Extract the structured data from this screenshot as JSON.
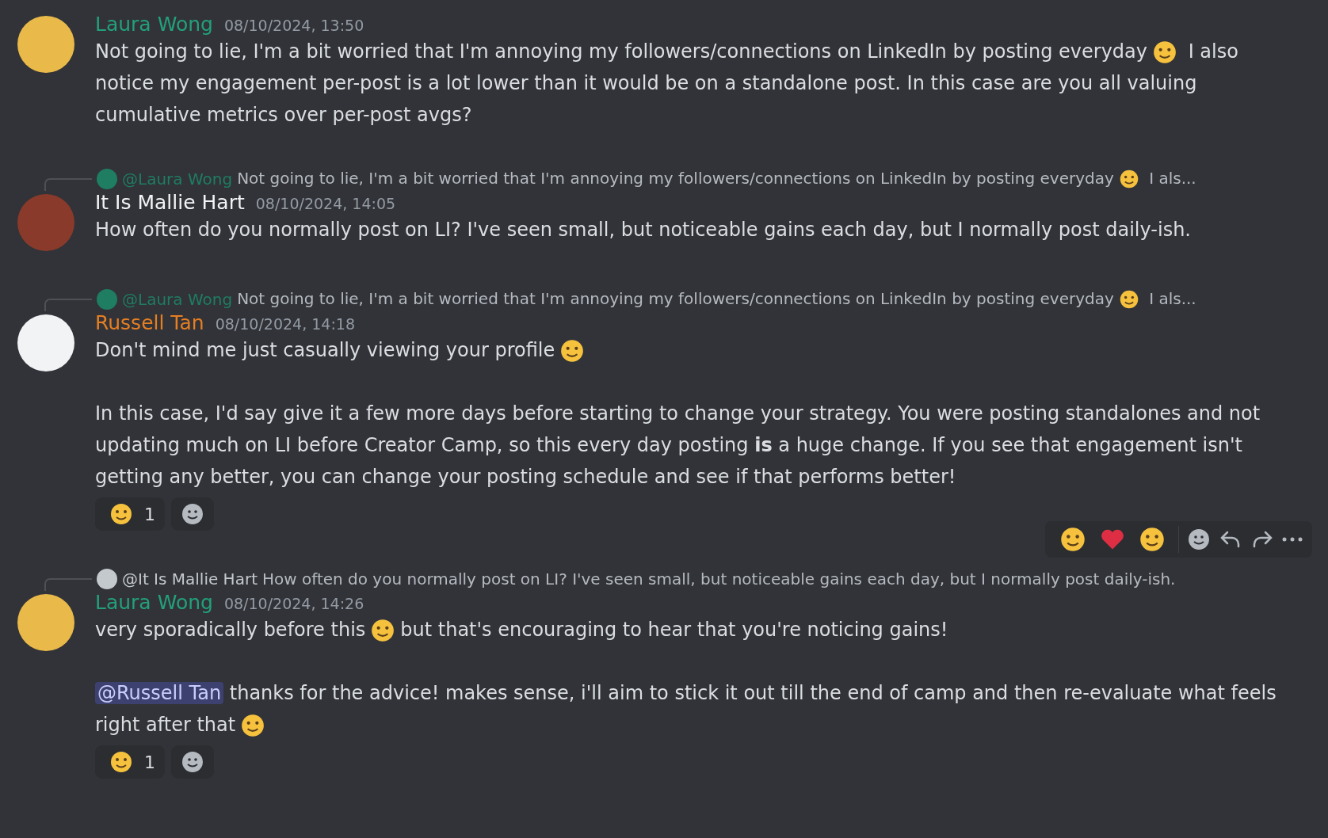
{
  "messages": [
    {
      "author": {
        "name": "Laura Wong",
        "color": "#23a07a",
        "avatar": {
          "color": "#e9b949"
        }
      },
      "timestamp": "08/10/2024, 13:50",
      "hovered": false,
      "paragraphs": [
        [
          {
            "kind": "text",
            "text": "Not going to lie, I'm a bit worried that I'm annoying my followers/connections on LinkedIn by posting everyday"
          },
          {
            "kind": "emoji"
          },
          {
            "kind": "text",
            "text": " I also notice my engagement per-post is a lot lower than it would be on a standalone post. In this case are you all valuing cumulative metrics over per-post avgs?"
          }
        ]
      ]
    },
    {
      "reply": {
        "author": "@Laura Wong",
        "color": "#1f7d61",
        "segments": [
          {
            "kind": "text",
            "text": "Not going to lie, I'm a bit worried that I'm annoying my followers/connections on LinkedIn by posting everyday"
          },
          {
            "kind": "emoji"
          },
          {
            "kind": "text",
            "text": " I als..."
          }
        ]
      },
      "author": {
        "name": "It Is Mallie Hart",
        "color": "#f2f3f5",
        "avatar": {
          "color": "#8a3a2a"
        }
      },
      "timestamp": "08/10/2024, 14:05",
      "hovered": false,
      "paragraphs": [
        [
          {
            "kind": "text",
            "text": "How often do you normally post on LI? I've seen small, but noticeable gains each day, but I normally post daily-ish."
          }
        ]
      ]
    },
    {
      "reply": {
        "author": "@Laura Wong",
        "color": "#1f7d61",
        "segments": [
          {
            "kind": "text",
            "text": "Not going to lie, I'm a bit worried that I'm annoying my followers/connections on LinkedIn by posting everyday"
          },
          {
            "kind": "emoji"
          },
          {
            "kind": "text",
            "text": " I als..."
          }
        ]
      },
      "author": {
        "name": "Russell Tan",
        "color": "#e67e22",
        "avatar": {
          "color": "#f2f3f5"
        }
      },
      "timestamp": "08/10/2024, 14:18",
      "hovered": false,
      "paragraphs": [
        [
          {
            "kind": "text",
            "text": "Don't mind me just casually viewing your profile"
          },
          {
            "kind": "emoji"
          }
        ],
        [
          {
            "kind": "text",
            "text": "In this case, I'd say give it a few more days before starting to change your strategy. You were posting standalones and not updating much on LI before Creator Camp, so this every day posting **is** a huge change. If you see that engagement isn't getting any better, you can change your posting schedule and see if that performs better!"
          }
        ]
      ],
      "reactions": [
        {
          "count": "1"
        }
      ]
    },
    {
      "reply": {
        "author": "@It Is Mallie Hart",
        "color": "#c4c9ce",
        "segments": [
          {
            "kind": "text",
            "text": "How often do you normally post on LI? I've seen small, but noticeable gains each day, but I normally post daily-ish."
          }
        ]
      },
      "author": {
        "name": "Laura Wong",
        "color": "#23a07a",
        "avatar": {
          "color": "#e9b949"
        }
      },
      "timestamp": "08/10/2024, 14:26",
      "hovered": true,
      "paragraphs": [
        [
          {
            "kind": "text",
            "text": "very sporadically before this"
          },
          {
            "kind": "emoji"
          },
          {
            "kind": "text",
            "text": "but that's encouraging to hear that you're noticing gains!"
          }
        ],
        [
          {
            "kind": "mention",
            "text": "@Russell Tan"
          },
          {
            "kind": "text",
            "text": " thanks for the advice! makes sense, i'll aim to stick it out till the end of camp and then re-evaluate what feels right after that"
          },
          {
            "kind": "emoji"
          }
        ]
      ],
      "reactions": [
        {
          "count": "1"
        }
      ]
    }
  ]
}
